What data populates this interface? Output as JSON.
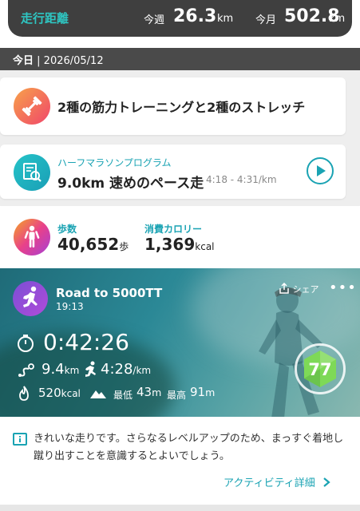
{
  "summary": {
    "label": "走行距離",
    "week_label": "今週",
    "week_value": "26.3",
    "week_unit": "km",
    "month_label": "今月",
    "month_value": "502.8",
    "month_unit": "km"
  },
  "date": {
    "prefix": "今日",
    "value": "2026/05/12"
  },
  "training": {
    "text": "2種の筋力トレーニングと2種のストレッチ"
  },
  "program": {
    "subtitle": "ハーフマラソンプログラム",
    "title": "9.0km 速めのペース走",
    "pace": "4:18 - 4:31/km"
  },
  "stats": {
    "steps_label": "歩数",
    "steps_value": "40,652",
    "steps_unit": "歩",
    "calories_label": "消費カロリー",
    "calories_value": "1,369",
    "calories_unit": "kcal"
  },
  "activity": {
    "title": "Road to 5000TT",
    "time": "19:13",
    "share_label": "シェア",
    "duration": "0:42:26",
    "distance": "9.4",
    "distance_unit": "km",
    "pace": "4:28",
    "pace_unit": "/km",
    "calories": "520",
    "calories_unit": "kcal",
    "alt_min_label": "最低",
    "alt_min": "43",
    "alt_max_label": "最高",
    "alt_max": "91",
    "alt_unit": "m",
    "score": "77"
  },
  "advice": {
    "text": "きれいな走りです。さらなるレベルアップのため、まっすぐ着地し蹴り出すことを意識するとよいでしょう。",
    "link": "アクティビティ詳細"
  },
  "colors": {
    "accent": "#1aa3b3",
    "topbar": "#3f3f3f",
    "score": "#7ed957"
  }
}
